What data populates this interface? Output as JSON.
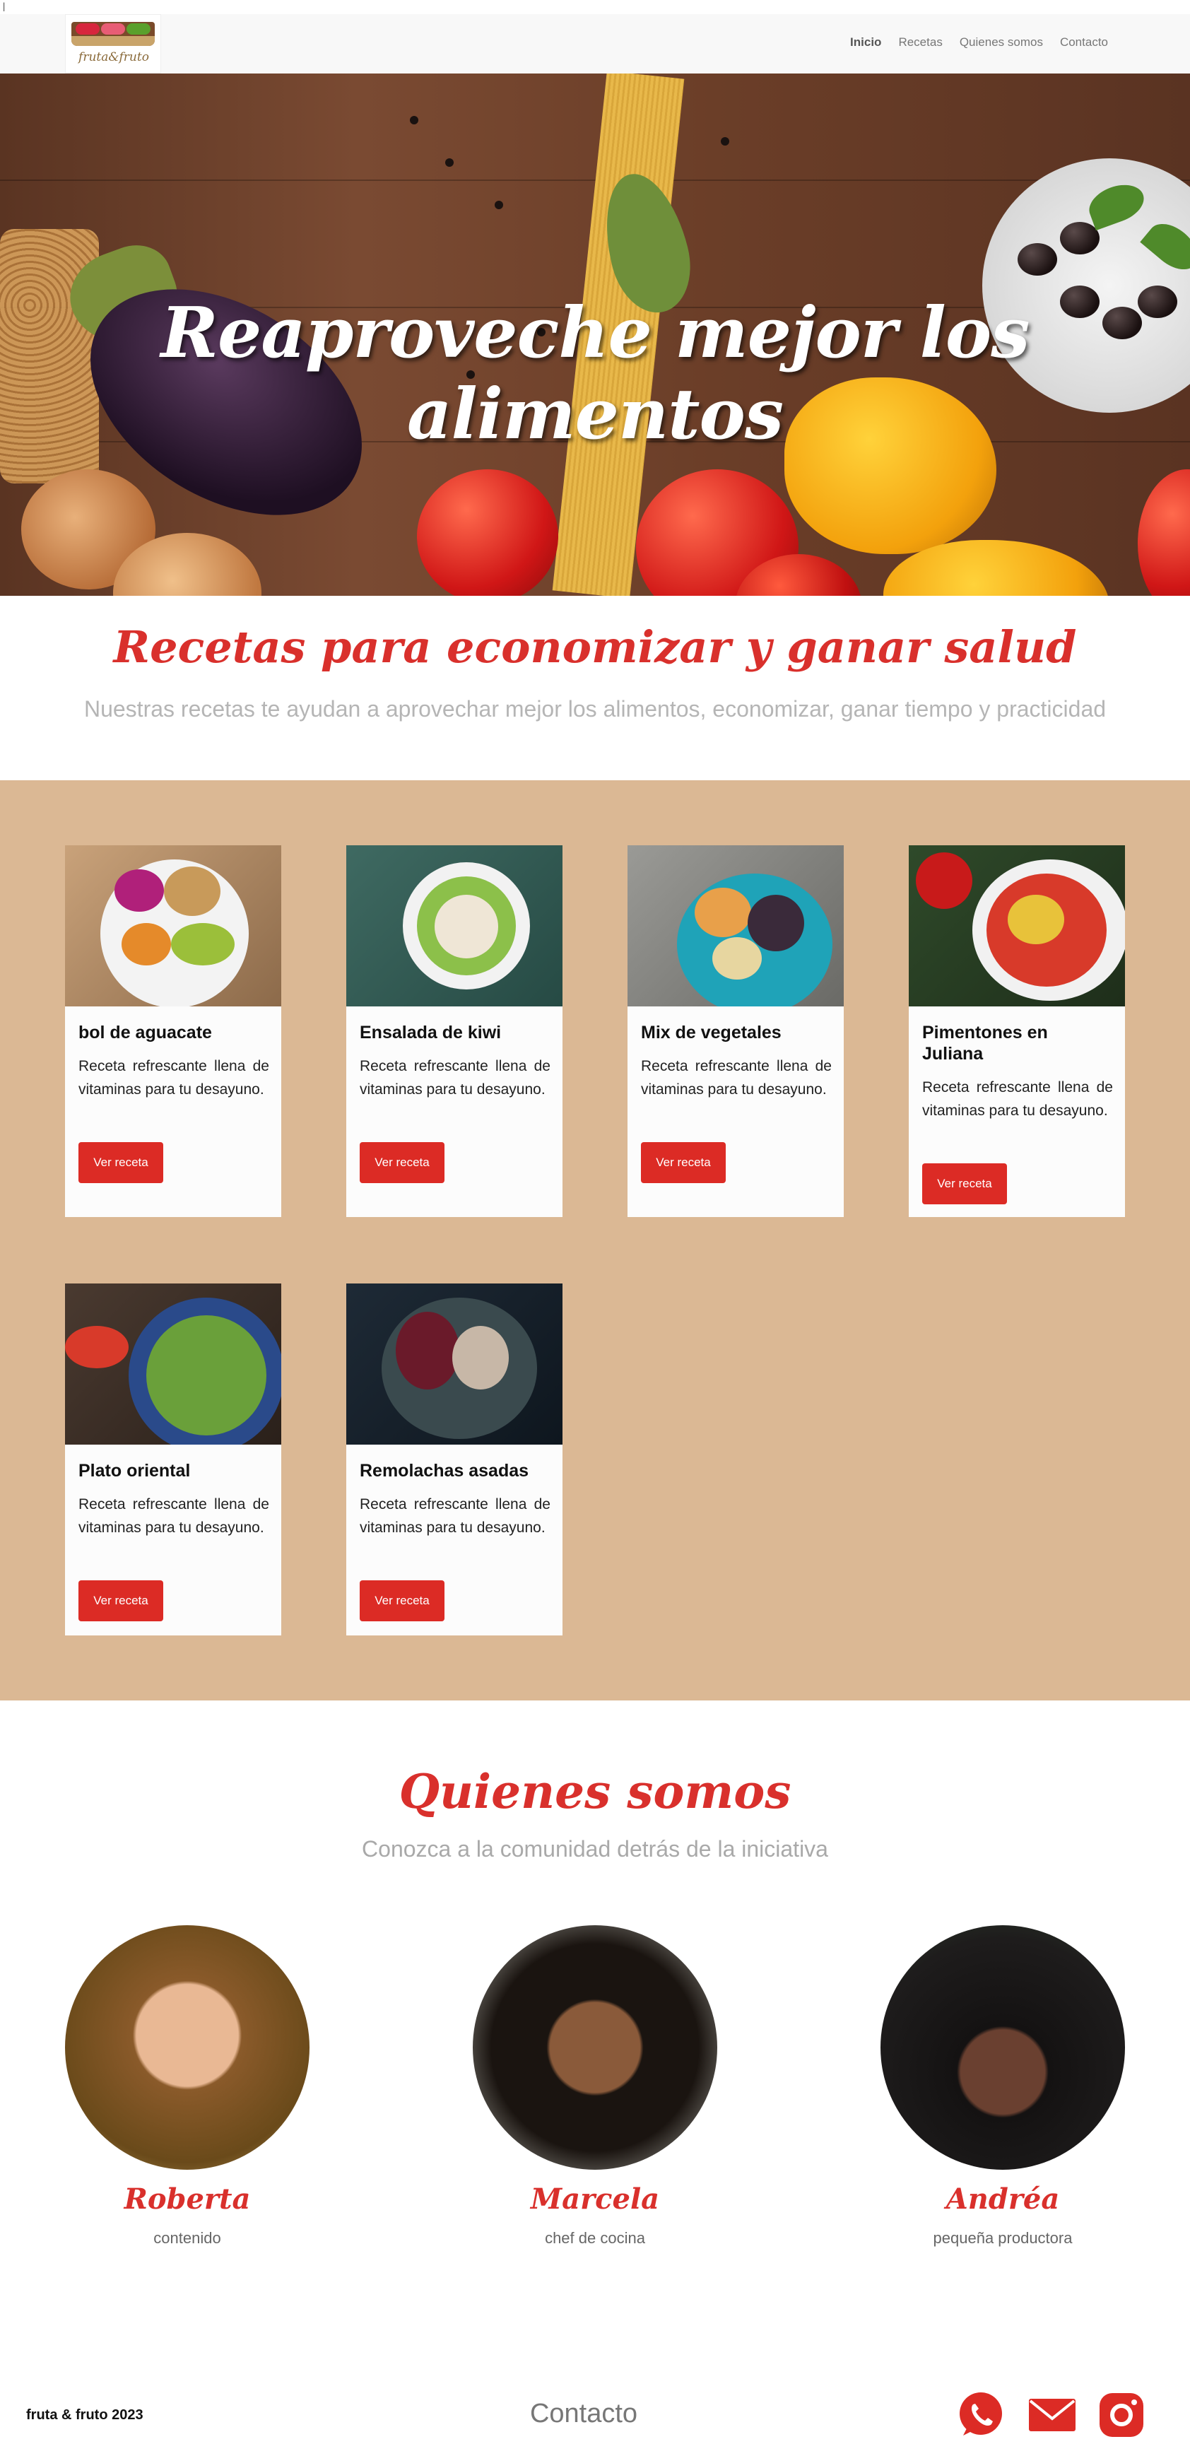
{
  "brand": {
    "name": "fruta&fruto"
  },
  "nav": {
    "items": [
      {
        "label": "Inicio",
        "active": true
      },
      {
        "label": "Recetas",
        "active": false
      },
      {
        "label": "Quienes somos",
        "active": false
      },
      {
        "label": "Contacto",
        "active": false
      }
    ]
  },
  "hero": {
    "title": "Reaproveche mejor los alimentos"
  },
  "recipes": {
    "title": "Recetas para economizar y ganar salud",
    "subtitle": "Nuestras recetas te ayudan a aprovechar mejor los alimentos, economizar, ganar tiempo y practicidad",
    "cards": [
      {
        "title": "bol de aguacate",
        "text": "Receta refrescante llena de vitaminas para tu desayuno.",
        "button": "Ver receta"
      },
      {
        "title": "Ensalada de kiwi",
        "text": "Receta refrescante llena de vitaminas para tu desayuno.",
        "button": "Ver receta"
      },
      {
        "title": "Mix de vegetales",
        "text": "Receta refrescante llena de vitaminas para tu desayuno.",
        "button": "Ver receta"
      },
      {
        "title": "Pimentones en Juliana",
        "text": "Receta refrescante llena de vitaminas para tu desayuno.",
        "button": "Ver receta"
      },
      {
        "title": "Plato oriental",
        "text": "Receta refrescante llena de vitaminas para tu desayuno.",
        "button": "Ver receta"
      },
      {
        "title": "Remolachas asadas",
        "text": "Receta refrescante llena de vitaminas para tu desayuno.",
        "button": "Ver receta"
      }
    ]
  },
  "about": {
    "title": "Quienes somos",
    "subtitle": "Conozca a la comunidad detrás de la iniciativa",
    "people": [
      {
        "name": "Roberta",
        "role": "contenido"
      },
      {
        "name": "Marcela",
        "role": "chef de cocina"
      },
      {
        "name": "Andréa",
        "role": "pequeña productora"
      }
    ]
  },
  "footer": {
    "copyright": "fruta & fruto 2023",
    "contact_label": "Contacto",
    "social": [
      {
        "icon": "whatsapp-icon"
      },
      {
        "icon": "mail-icon"
      },
      {
        "icon": "instagram-icon"
      }
    ]
  },
  "colors": {
    "accent": "#d9302c",
    "button": "#dc2b25",
    "cards_background": "#dbb894",
    "navbar_background": "#f8f8f8"
  }
}
